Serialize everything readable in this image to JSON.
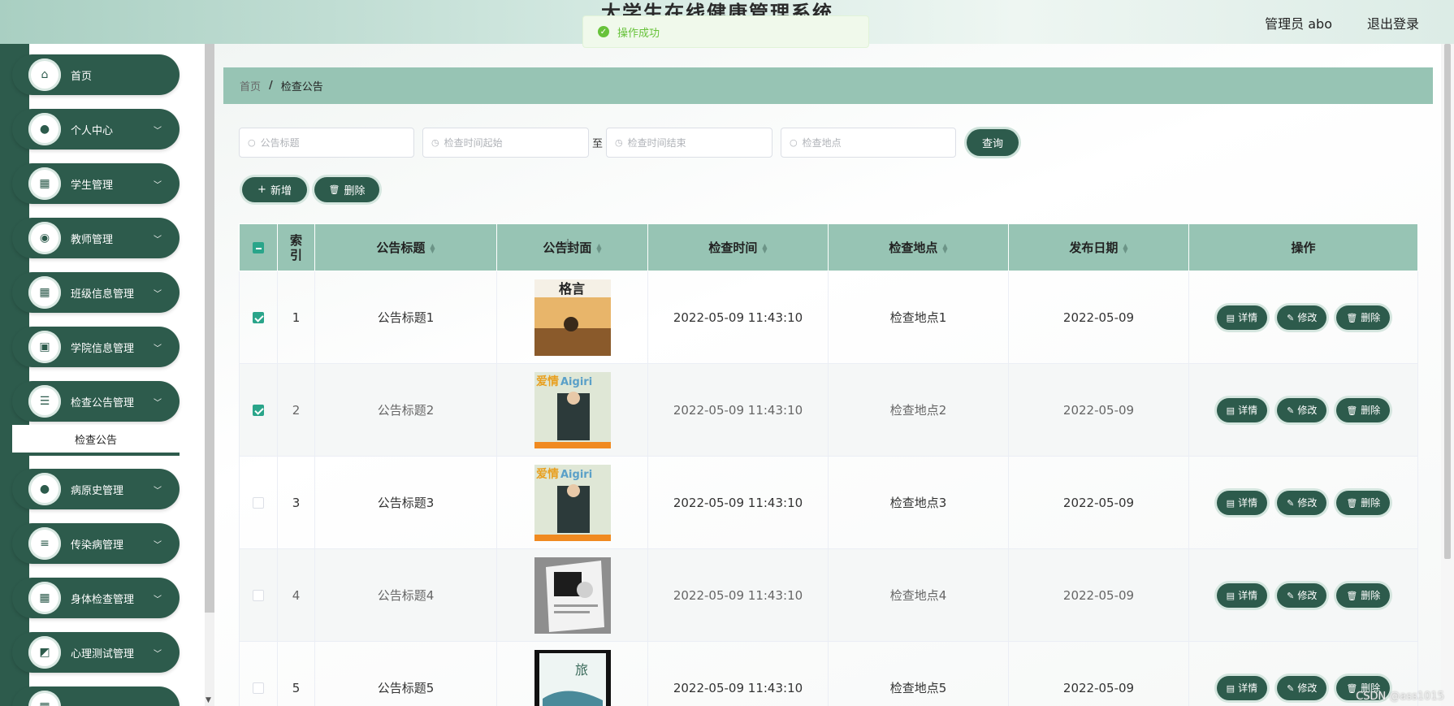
{
  "header": {
    "system_title": "大学生在线健康管理系统",
    "user_label": "管理员 abo",
    "logout": "退出登录"
  },
  "toast": {
    "message": "操作成功"
  },
  "sidebar": {
    "items": [
      {
        "label": "首页",
        "icon": "home-icon",
        "has_children": false
      },
      {
        "label": "个人中心",
        "icon": "user-icon",
        "has_children": true
      },
      {
        "label": "学生管理",
        "icon": "grid-icon",
        "has_children": true
      },
      {
        "label": "教师管理",
        "icon": "bulb-icon",
        "has_children": true
      },
      {
        "label": "班级信息管理",
        "icon": "grid-icon",
        "has_children": true
      },
      {
        "label": "学院信息管理",
        "icon": "briefcase-icon",
        "has_children": true
      },
      {
        "label": "检查公告管理",
        "icon": "sliders-icon",
        "has_children": true
      },
      {
        "label": "病原史管理",
        "icon": "user-icon",
        "has_children": true
      },
      {
        "label": "传染病管理",
        "icon": "list-icon",
        "has_children": true
      },
      {
        "label": "身体检查管理",
        "icon": "grid-icon",
        "has_children": true
      },
      {
        "label": "心理测试管理",
        "icon": "chart-icon",
        "has_children": true
      }
    ],
    "active_submenu": "检查公告"
  },
  "breadcrumb": {
    "home": "首页",
    "separator": "/",
    "current": "检查公告"
  },
  "search": {
    "title_placeholder": "公告标题",
    "start_placeholder": "检查时间起始",
    "range_sep": "至",
    "end_placeholder": "检查时间结束",
    "location_placeholder": "检查地点",
    "query_button": "查询"
  },
  "toolbar": {
    "add_button": "新增",
    "delete_button": "删除"
  },
  "table": {
    "headers": {
      "index": "索引",
      "title": "公告标题",
      "cover": "公告封面",
      "check_time": "检查时间",
      "location": "检查地点",
      "publish_date": "发布日期",
      "actions": "操作"
    },
    "actions": {
      "detail": "详情",
      "edit": "修改",
      "delete": "删除"
    },
    "rows": [
      {
        "index": "1",
        "title": "公告标题1",
        "check_time": "2022-05-09 11:43:10",
        "location": "检查地点1",
        "publish_date": "2022-05-09",
        "checked": true
      },
      {
        "index": "2",
        "title": "公告标题2",
        "check_time": "2022-05-09 11:43:10",
        "location": "检查地点2",
        "publish_date": "2022-05-09",
        "checked": true
      },
      {
        "index": "3",
        "title": "公告标题3",
        "check_time": "2022-05-09 11:43:10",
        "location": "检查地点3",
        "publish_date": "2022-05-09",
        "checked": false
      },
      {
        "index": "4",
        "title": "公告标题4",
        "check_time": "2022-05-09 11:43:10",
        "location": "检查地点4",
        "publish_date": "2022-05-09",
        "checked": false
      },
      {
        "index": "5",
        "title": "公告标题5",
        "check_time": "2022-05-09 11:43:10",
        "location": "检查地点5",
        "publish_date": "2022-05-09",
        "checked": false
      }
    ]
  },
  "watermark": "CSDN @ass1015",
  "colors": {
    "primary": "#2d5b4c",
    "header_bg": "#97c4b4",
    "success": "#67c23a"
  }
}
